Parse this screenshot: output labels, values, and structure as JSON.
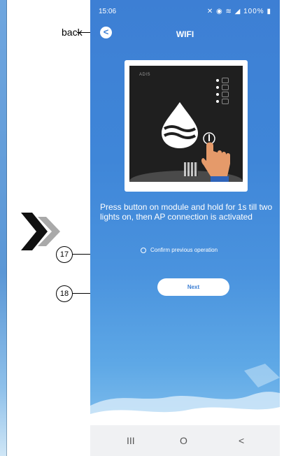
{
  "status": {
    "time": "15:06",
    "battery": "100%"
  },
  "header": {
    "title": "WIFI",
    "back_symbol": "<"
  },
  "device": {
    "brand": "ADIS"
  },
  "instructions": "Press button on module and hold for 1s till two lights on, then AP connection is activated",
  "confirm_label": "Confirm previous operation",
  "next_label": "Next",
  "navbar": {
    "recents": "III",
    "home": "O",
    "back": "<"
  },
  "annotations": {
    "back": "back",
    "c17": "17",
    "c18": "18"
  },
  "colors": {
    "primary": "#3d7fd4",
    "background_light": "#8fc7ef",
    "white": "#ffffff"
  },
  "icons": [
    "water-drop-icon",
    "hand-pointer-icon",
    "wifi-icon",
    "battery-icon",
    "signal-icon",
    "chevron-right-icon"
  ]
}
